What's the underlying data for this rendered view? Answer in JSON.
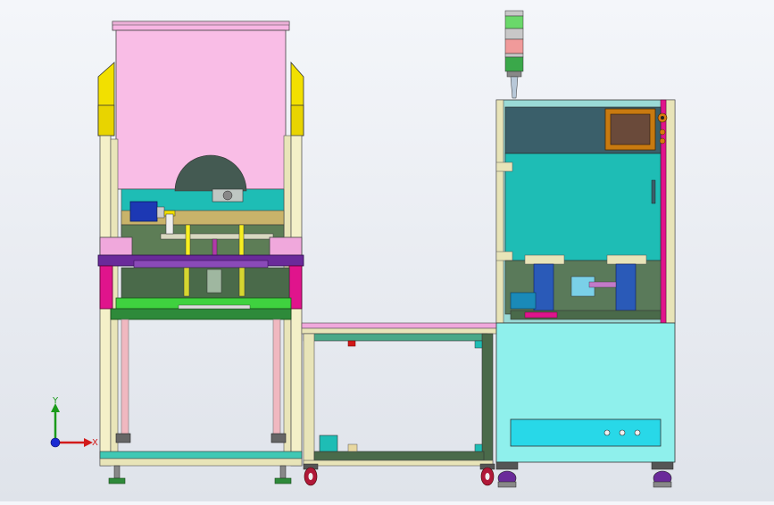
{
  "viewport": {
    "background_top": "#f4f6fa",
    "background_bottom": "#dfe3ea"
  },
  "triad": {
    "y_label": "Y",
    "x_label": "X",
    "y_color": "#1a9a1a",
    "x_color": "#d21a1a",
    "z_color": "#1a2ad2"
  },
  "colors": {
    "hood_pink": "#f7b6e3",
    "guard_yellow": "#f2e000",
    "frame_cream": "#f4f0c8",
    "magenta": "#e0148c",
    "purple": "#6a2a9a",
    "green_plate": "#3fd23f",
    "cabinet_cyan": "#8ff0ec",
    "panel_teal": "#1ebdb5",
    "upper_gray": "#3a5f6a",
    "olive": "#5a7a4a",
    "hmi_orange": "#c87a10"
  },
  "control_panel": {
    "indicator_count": 3
  }
}
